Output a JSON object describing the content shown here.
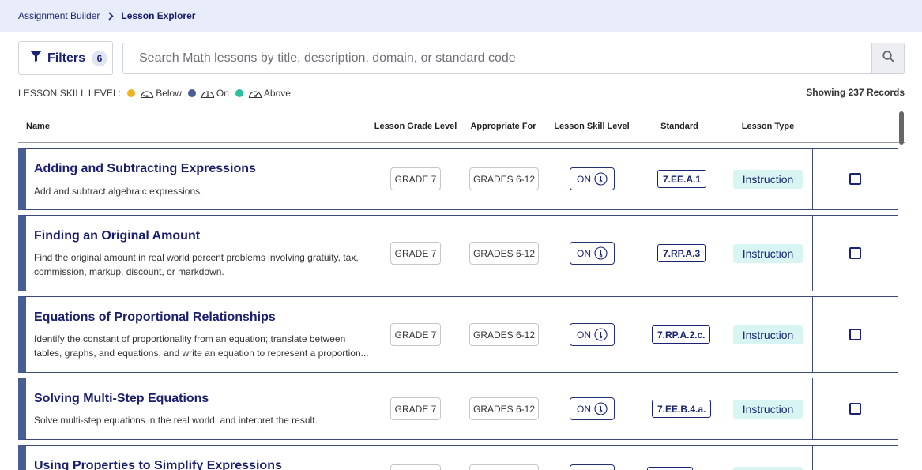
{
  "breadcrumb": {
    "parent": "Assignment Builder",
    "current": "Lesson Explorer"
  },
  "filters": {
    "label": "Filters",
    "count": "6"
  },
  "search": {
    "placeholder": "Search Math lessons by title, description, domain, or standard code",
    "value": ""
  },
  "legend": {
    "title": "LESSON SKILL LEVEL:",
    "items": [
      {
        "label": "Below",
        "color": "#f0b323",
        "icon": "gauge-below-icon"
      },
      {
        "label": "On",
        "color": "#4a5d93",
        "icon": "gauge-on-icon"
      },
      {
        "label": "Above",
        "color": "#2fbf9e",
        "icon": "gauge-above-icon"
      }
    ]
  },
  "records": "Showing 237 Records",
  "table": {
    "headers": {
      "name": "Name",
      "grade": "Lesson Grade Level",
      "appropriate": "Appropriate For",
      "skill": "Lesson Skill Level",
      "standard": "Standard",
      "type": "Lesson Type"
    },
    "rows": [
      {
        "title": "Adding and Subtracting Expressions",
        "desc": "Add and subtract algebraic expressions.",
        "grade": "GRADE 7",
        "appropriate": "GRADES 6-12",
        "skill": "ON",
        "standard": "7.EE.A.1",
        "type": "Instruction"
      },
      {
        "title": "Finding an Original Amount",
        "desc": "Find the original amount in real world percent problems involving gratuity, tax, commission, markup, discount, or markdown.",
        "grade": "GRADE 7",
        "appropriate": "GRADES 6-12",
        "skill": "ON",
        "standard": "7.RP.A.3",
        "type": "Instruction"
      },
      {
        "title": "Equations of Proportional Relationships",
        "desc": "Identify the constant of proportionality from an equation; translate between tables, graphs, and equations, and write an equation to represent a proportion...",
        "grade": "GRADE 7",
        "appropriate": "GRADES 6-12",
        "skill": "ON",
        "standard": "7.RP.A.2.c.",
        "type": "Instruction"
      },
      {
        "title": "Solving Multi-Step Equations",
        "desc": "Solve multi-step equations in the real world, and interpret the result.",
        "grade": "GRADE 7",
        "appropriate": "GRADES 6-12",
        "skill": "ON",
        "standard": "7.EE.B.4.a.",
        "type": "Instruction"
      },
      {
        "title": "Using Properties to Simplify Expressions",
        "desc": "",
        "grade": "",
        "appropriate": "",
        "skill": "",
        "standard": "",
        "type": ""
      }
    ]
  },
  "colors": {
    "accent": "#1a2372",
    "rowBar": "#4a5d93",
    "typeBadge": "#d8f5f4",
    "crumbBg": "#e9edfb"
  }
}
